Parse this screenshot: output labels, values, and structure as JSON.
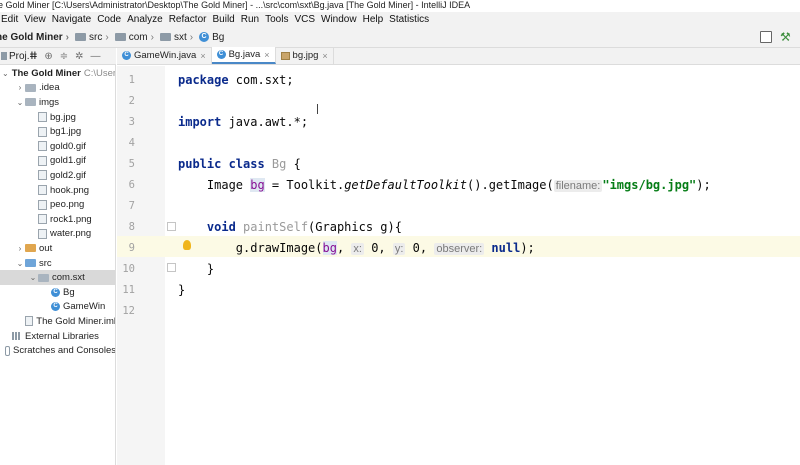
{
  "window": {
    "title": "e Gold Miner [C:\\Users\\Administrator\\Desktop\\The Gold Miner] - ...\\src\\com\\sxt\\Bg.java [The Gold Miner] - IntelliJ IDEA"
  },
  "menu": [
    "Edit",
    "View",
    "Navigate",
    "Code",
    "Analyze",
    "Refactor",
    "Build",
    "Run",
    "Tools",
    "VCS",
    "Window",
    "Help",
    "Statistics"
  ],
  "breadcrumbs": {
    "project": "he Gold Miner",
    "items": [
      "src",
      "com",
      "sxt",
      "Bg"
    ]
  },
  "project_panel": {
    "tab_label": "Proj.ⵌ",
    "toolbar_icons": [
      "target-icon",
      "collapse-icon",
      "gear-icon",
      "minimize-icon"
    ]
  },
  "tree": [
    {
      "label": "The Gold Miner",
      "path": "C:\\Users",
      "indent": 0,
      "expanded": true,
      "kind": "project"
    },
    {
      "label": ".idea",
      "indent": 1,
      "expanded": false,
      "kind": "dir"
    },
    {
      "label": "imgs",
      "indent": 1,
      "expanded": true,
      "kind": "dir"
    },
    {
      "label": "bg.jpg",
      "indent": 2,
      "kind": "file"
    },
    {
      "label": "bg1.jpg",
      "indent": 2,
      "kind": "file"
    },
    {
      "label": "gold0.gif",
      "indent": 2,
      "kind": "file"
    },
    {
      "label": "gold1.gif",
      "indent": 2,
      "kind": "file"
    },
    {
      "label": "gold2.gif",
      "indent": 2,
      "kind": "file"
    },
    {
      "label": "hook.png",
      "indent": 2,
      "kind": "file"
    },
    {
      "label": "peo.png",
      "indent": 2,
      "kind": "file"
    },
    {
      "label": "rock1.png",
      "indent": 2,
      "kind": "file"
    },
    {
      "label": "water.png",
      "indent": 2,
      "kind": "file"
    },
    {
      "label": "out",
      "indent": 1,
      "expanded": false,
      "kind": "out"
    },
    {
      "label": "src",
      "indent": 1,
      "expanded": true,
      "kind": "src"
    },
    {
      "label": "com.sxt",
      "indent": 2,
      "expanded": true,
      "kind": "pkg",
      "selected": true
    },
    {
      "label": "Bg",
      "indent": 3,
      "kind": "class"
    },
    {
      "label": "GameWin",
      "indent": 3,
      "kind": "class"
    },
    {
      "label": "The Gold Miner.iml",
      "indent": 1,
      "kind": "file"
    },
    {
      "label": "External Libraries",
      "indent": 0,
      "kind": "lib"
    },
    {
      "label": "Scratches and Consoles",
      "indent": 0,
      "kind": "scratch"
    }
  ],
  "editor_tabs": [
    {
      "label": "GameWin.java",
      "kind": "class",
      "active": false
    },
    {
      "label": "Bg.java",
      "kind": "class",
      "active": true
    },
    {
      "label": "bg.jpg",
      "kind": "image",
      "active": false
    }
  ],
  "code": {
    "line_numbers": [
      "1",
      "2",
      "3",
      "4",
      "5",
      "6",
      "7",
      "8",
      "9",
      "10",
      "11",
      "12"
    ],
    "l1_kw": "package",
    "l1_rest": " com.sxt;",
    "l3_kw": "import",
    "l3_rest": " java.awt.*;",
    "l5_kw": "public class",
    "l5_name": " Bg",
    "l5_brace": " {",
    "l6_a": "    Image ",
    "l6_field": "bg",
    "l6_b": " = Toolkit.",
    "l6_method": "getDefaultToolkit",
    "l6_c": "().getImage(",
    "l6_hint": "filename:",
    "l6_str": "\"imgs/bg.jpg\"",
    "l6_d": ");",
    "l8_kw": "    void",
    "l8_name": " paintSelf",
    "l8_rest": "(Graphics g){",
    "l9_a": "        g.drawImage(",
    "l9_field": "bg",
    "l9_sep1": ", ",
    "l9_hint_x": "x:",
    "l9_x": " 0, ",
    "l9_hint_y": "y:",
    "l9_y": " 0, ",
    "l9_hint_obs": "observer:",
    "l9_kw": " null",
    "l9_end": ");",
    "l10": "    }",
    "l11": "}"
  }
}
